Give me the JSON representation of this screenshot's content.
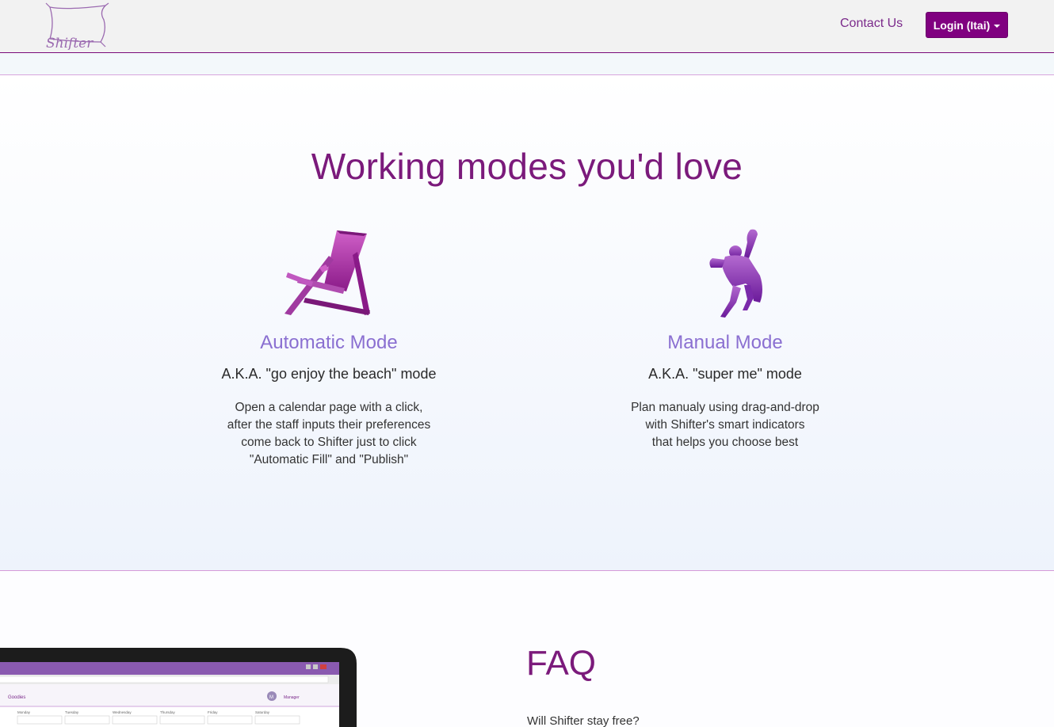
{
  "header": {
    "logo_text": "Shifter",
    "contact_label": "Contact Us",
    "login_label": "Login (Itai)"
  },
  "modes": {
    "title": "Working modes you'd love",
    "items": [
      {
        "heading": "Automatic Mode",
        "aka": "A.K.A. \"go enjoy the beach\" mode",
        "desc_lines": [
          "Open a calendar page with a click,",
          "after the staff inputs their preferences",
          "come back to Shifter just to click",
          "\"Automatic Fill\" and \"Publish\""
        ],
        "icon": "beach-chair-icon"
      },
      {
        "heading": "Manual Mode",
        "aka": "A.K.A. \"super me\" mode",
        "desc_lines": [
          "Plan manualy using drag-and-drop",
          "with Shifter's smart indicators",
          "that helps you choose best"
        ],
        "icon": "superhero-icon"
      }
    ]
  },
  "faq": {
    "title": "FAQ",
    "questions": [
      "Will Shifter stay free?"
    ]
  },
  "laptop_screen": {
    "tab_label": "Goodies",
    "avatar_letter": "M",
    "user_role": "Manager",
    "days": [
      "Monday",
      "Tuesday",
      "Wednesday",
      "Thursday",
      "Friday",
      "Saturday"
    ]
  },
  "colors": {
    "brand_purple": "#800080",
    "heading_purple": "#7b1a7b",
    "mode_heading": "#8a6fd1"
  }
}
